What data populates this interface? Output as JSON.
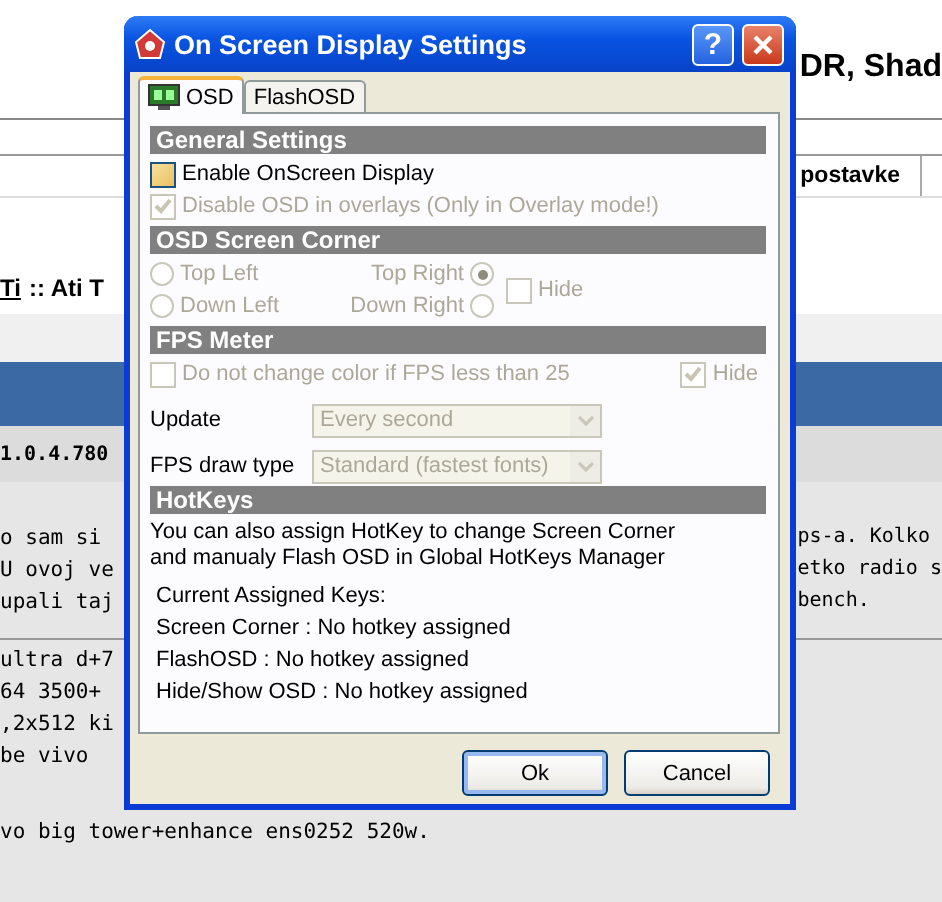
{
  "background": {
    "heading": "DR, Shad",
    "column_header": "postavke",
    "breadcrumb": [
      {
        "text": "Ti",
        "kind": "link"
      },
      {
        "text": ":: Ati T",
        "kind": "text"
      }
    ],
    "version": "1.0.4.780",
    "left_lines": [
      "o sam si",
      "U ovoj ve",
      "upali taj"
    ],
    "right_lines": [
      "ps-a. Kolko",
      "etko radio s",
      "bench."
    ],
    "spec_lines": [
      "ultra d+7",
      "64 3500+",
      ",2x512 ki",
      "be vivo",
      "vo big tower+enhance ens0252 520w."
    ]
  },
  "dialog": {
    "title": "On Screen Display Settings",
    "help_label": "?",
    "tabs": [
      {
        "label": "OSD",
        "selected": true,
        "icon": true
      },
      {
        "label": "FlashOSD",
        "selected": false,
        "icon": false
      }
    ],
    "sections": [
      {
        "title": "General Settings",
        "items": [
          {
            "kind": "checkbox",
            "label": "Enable OnScreen Display",
            "checked": false,
            "disabled": false
          },
          {
            "kind": "checkbox",
            "label": "Disable OSD in overlays (Only in Overlay mode!)",
            "checked": true,
            "disabled": true
          }
        ]
      },
      {
        "title": "OSD Screen Corner",
        "items": [
          {
            "kind": "corner",
            "disabled": true,
            "radios": [
              {
                "label": "Top Left",
                "selected": false
              },
              {
                "label": "Top Right",
                "selected": true
              },
              {
                "label": "Down Left",
                "selected": false
              },
              {
                "label": "Down Right",
                "selected": false
              }
            ],
            "hide": {
              "label": "Hide",
              "checked": false
            }
          }
        ]
      },
      {
        "title": "FPS Meter",
        "items": [
          {
            "kind": "split",
            "disabled": true,
            "label": "Do not change color if FPS less than 25",
            "checked": false,
            "side": {
              "label": "Hide",
              "checked": true
            }
          },
          {
            "kind": "select",
            "label": "Update",
            "value": "Every second",
            "disabled": true
          },
          {
            "kind": "select",
            "label": "FPS draw type",
            "value": "Standard (fastest fonts)",
            "disabled": true
          }
        ]
      },
      {
        "title": "HotKeys",
        "items": [
          {
            "kind": "paragraph",
            "lines": [
              "You can also assign HotKey to change Screen Corner",
              "and manualy Flash OSD in Global HotKeys Manager"
            ]
          },
          {
            "kind": "list",
            "lines": [
              "Current Assigned Keys:",
              "Screen Corner : No hotkey assigned",
              "FlashOSD : No hotkey assigned",
              "Hide/Show OSD : No hotkey assigned"
            ]
          }
        ]
      }
    ],
    "buttons": [
      {
        "label": "Ok",
        "default": true
      },
      {
        "label": "Cancel",
        "default": false
      }
    ]
  }
}
